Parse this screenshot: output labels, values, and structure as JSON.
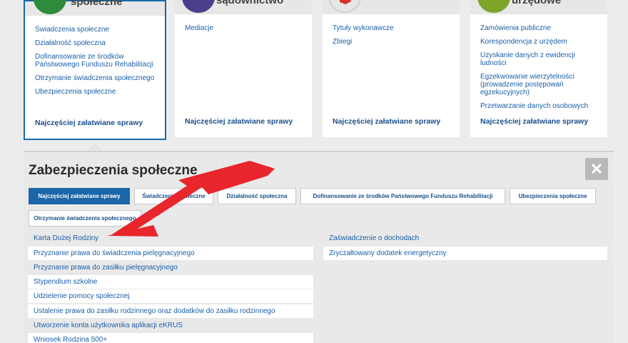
{
  "cards": [
    {
      "title": "społeczne",
      "icon": "people-icon",
      "icon_color": "#2e8b3c",
      "links": [
        "Świadczenia społeczne",
        "Działalność społeczna",
        "Dofinansowanie ze środków Państwowego Funduszu Rehabilitacji",
        "Otrzymanie świadczenia społecznego",
        "Ubezpieczenia społeczne"
      ],
      "frequent": "Najczęściej załatwiane sprawy"
    },
    {
      "title": "sądownictwo",
      "icon": "scales-icon",
      "icon_color": "#4a3f8c",
      "links": [
        "Mediacje"
      ],
      "frequent": "Najczęściej załatwiane sprawy"
    },
    {
      "title": "",
      "icon": "map-icon",
      "icon_color": "#e6e6e6",
      "links": [
        "Tytuły wykonawcze",
        "Zbiegi"
      ],
      "frequent": "Najczęściej załatwiane sprawy"
    },
    {
      "title": "urzędowe",
      "icon": "office-icon",
      "icon_color": "#7ea52a",
      "links": [
        "Zamówienia publiczne",
        "Korespondencja z urzędem",
        "Uzyskanie danych z ewidencji ludności",
        "Egzekwowanie wierzytelności (prowadzenie postępowań egzekucyjnych)",
        "Przetwarzanie danych osobowych"
      ],
      "frequent": "Najczęściej załatwiane sprawy"
    }
  ],
  "panel": {
    "title": "Zabezpieczenia społeczne",
    "close": "✕",
    "tabs": [
      "Najczęściej załatwiane sprawy",
      "Świadczenia społeczne",
      "Działalność społeczna",
      "Dofinansowanie ze środków Państwowego Funduszu Rehabilitacji",
      "Ubezpieczenia społeczne",
      "Otrzymanie świadczenia społecznego"
    ],
    "left_items": [
      "Karta Dużej Rodziny",
      "Przyznanie prawa do świadczenia pielęgnacyjnego",
      "Przyznanie prawa do zasiłku pielęgnacyjnego",
      "Stypendium szkolne",
      "Udzielenie pomocy społecznej",
      "Ustalenie prawa do zasiłku rodzinnego oraz dodatków do zasiłku rodzinnego",
      "Utworzenie konta użytkownika aplikacji eKRUS",
      "Wniosek Rodzina 500+"
    ],
    "right_items": [
      "Zaświadczenie o dochodach",
      "Zryczałtowany dodatek energetyczny"
    ]
  },
  "colors": {
    "accent": "#1b66a9",
    "arrow": "#e8262b"
  }
}
